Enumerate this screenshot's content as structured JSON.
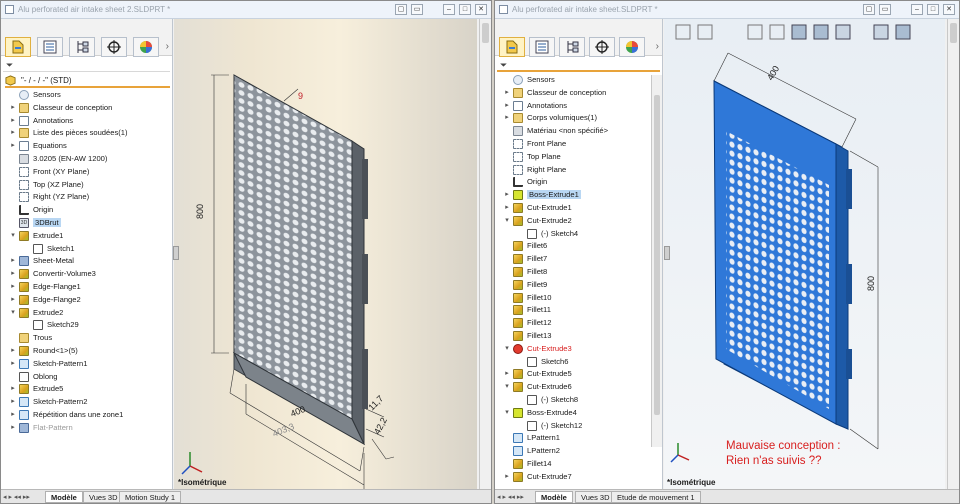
{
  "left": {
    "title": "Alu perforated air intake sheet 2.SLDPRT *",
    "root_label": "\"- / - / -\" (STD)",
    "tree": [
      {
        "label": "Sensors",
        "icon": "sensor-icon",
        "indent": 0,
        "exp": ""
      },
      {
        "label": "Classeur de conception",
        "icon": "folder-icon",
        "indent": 0,
        "exp": "▸"
      },
      {
        "label": "Annotations",
        "icon": "annotations-icon",
        "indent": 0,
        "exp": "▸"
      },
      {
        "label": "Liste des pièces soudées(1)",
        "icon": "folder-icon",
        "indent": 0,
        "exp": "▸"
      },
      {
        "label": "Equations",
        "icon": "equations-icon",
        "indent": 0,
        "exp": "▸"
      },
      {
        "label": "3.0205 (EN-AW 1200)",
        "icon": "material-icon",
        "indent": 0,
        "exp": ""
      },
      {
        "label": "Front (XY Plane)",
        "icon": "plane-icon",
        "indent": 0,
        "exp": ""
      },
      {
        "label": "Top (XZ Plane)",
        "icon": "plane-icon",
        "indent": 0,
        "exp": ""
      },
      {
        "label": "Right (YZ Plane)",
        "icon": "plane-icon",
        "indent": 0,
        "exp": ""
      },
      {
        "label": "Origin",
        "icon": "origin-icon",
        "indent": 0,
        "exp": ""
      },
      {
        "label": "3DBrut",
        "icon": "sketch3d-icon",
        "indent": 0,
        "exp": "",
        "selected": true
      },
      {
        "label": "Extrude1",
        "icon": "extrude-icon",
        "indent": 0,
        "exp": "▾"
      },
      {
        "label": "Sketch1",
        "icon": "sketch-icon",
        "indent": 1,
        "exp": ""
      },
      {
        "label": "Sheet-Metal",
        "icon": "sheet-metal-icon",
        "indent": 0,
        "exp": "▸"
      },
      {
        "label": "Convertir-Volume3",
        "icon": "convert-icon",
        "indent": 0,
        "exp": "▸"
      },
      {
        "label": "Edge-Flange1",
        "icon": "flange-icon",
        "indent": 0,
        "exp": "▸"
      },
      {
        "label": "Edge-Flange2",
        "icon": "flange-icon",
        "indent": 0,
        "exp": "▸"
      },
      {
        "label": "Extrude2",
        "icon": "extrude-icon",
        "indent": 0,
        "exp": "▾"
      },
      {
        "label": "Sketch29",
        "icon": "sketch-icon",
        "indent": 1,
        "exp": ""
      },
      {
        "label": "Trous",
        "icon": "folder-icon",
        "indent": 0,
        "exp": ""
      },
      {
        "label": "Round<1>(5)",
        "icon": "feature-icon",
        "indent": 0,
        "exp": "▸"
      },
      {
        "label": "Sketch-Pattern1",
        "icon": "pattern-icon",
        "indent": 0,
        "exp": "▸"
      },
      {
        "label": "Oblong",
        "icon": "sketch-icon",
        "indent": 0,
        "exp": ""
      },
      {
        "label": "Extrude5",
        "icon": "extrude-icon",
        "indent": 0,
        "exp": "▸"
      },
      {
        "label": "Sketch-Pattern2",
        "icon": "pattern-icon",
        "indent": 0,
        "exp": "▸"
      },
      {
        "label": "Répétition dans une zone1",
        "icon": "pattern-icon",
        "indent": 0,
        "exp": "▸"
      },
      {
        "label": "Flat-Pattern",
        "icon": "flat-pattern-icon",
        "indent": 0,
        "exp": "▸",
        "grey": true
      }
    ],
    "tabs": [
      "Modèle",
      "Vues 3D",
      "Motion Study 1"
    ],
    "view_label": "*Isométrique",
    "dims": {
      "height": "800",
      "width": "400",
      "diag": "403,3",
      "depth": "42,2",
      "flange": "11,7",
      "hole": "9"
    }
  },
  "right": {
    "title": "Alu perforated air intake sheet.SLDPRT *",
    "tree": [
      {
        "label": "Sensors",
        "icon": "sensor-icon",
        "indent": 0,
        "exp": ""
      },
      {
        "label": "Classeur de conception",
        "icon": "folder-icon",
        "indent": 0,
        "exp": "▸"
      },
      {
        "label": "Annotations",
        "icon": "annotations-icon",
        "indent": 0,
        "exp": "▸"
      },
      {
        "label": "Corps volumiques(1)",
        "icon": "folder-icon",
        "indent": 0,
        "exp": "▸"
      },
      {
        "label": "Matériau <non spécifié>",
        "icon": "material-icon",
        "indent": 0,
        "exp": ""
      },
      {
        "label": "Front Plane",
        "icon": "plane-icon",
        "indent": 0,
        "exp": ""
      },
      {
        "label": "Top Plane",
        "icon": "plane-icon",
        "indent": 0,
        "exp": ""
      },
      {
        "label": "Right Plane",
        "icon": "plane-icon",
        "indent": 0,
        "exp": ""
      },
      {
        "label": "Origin",
        "icon": "origin-icon",
        "indent": 0,
        "exp": ""
      },
      {
        "label": "Boss-Extrude1",
        "icon": "boss-icon",
        "indent": 0,
        "exp": "▸",
        "selected": true
      },
      {
        "label": "Cut-Extrude1",
        "icon": "cut-icon",
        "indent": 0,
        "exp": "▸"
      },
      {
        "label": "Cut-Extrude2",
        "icon": "cut-icon",
        "indent": 0,
        "exp": "▾"
      },
      {
        "label": "(-) Sketch4",
        "icon": "sketch-icon",
        "indent": 1,
        "exp": ""
      },
      {
        "label": "Fillet6",
        "icon": "fillet-icon",
        "indent": 0,
        "exp": ""
      },
      {
        "label": "Fillet7",
        "icon": "fillet-icon",
        "indent": 0,
        "exp": ""
      },
      {
        "label": "Fillet8",
        "icon": "fillet-icon",
        "indent": 0,
        "exp": ""
      },
      {
        "label": "Fillet9",
        "icon": "fillet-icon",
        "indent": 0,
        "exp": ""
      },
      {
        "label": "Fillet10",
        "icon": "fillet-icon",
        "indent": 0,
        "exp": ""
      },
      {
        "label": "Fillet11",
        "icon": "fillet-icon",
        "indent": 0,
        "exp": ""
      },
      {
        "label": "Fillet12",
        "icon": "fillet-icon",
        "indent": 0,
        "exp": ""
      },
      {
        "label": "Fillet13",
        "icon": "fillet-icon",
        "indent": 0,
        "exp": ""
      },
      {
        "label": "Cut-Extrude3",
        "icon": "error-icon",
        "indent": 0,
        "exp": "▾",
        "error": true
      },
      {
        "label": "Sketch6",
        "icon": "sketch-icon",
        "indent": 1,
        "exp": ""
      },
      {
        "label": "Cut-Extrude5",
        "icon": "cut-icon",
        "indent": 0,
        "exp": "▸"
      },
      {
        "label": "Cut-Extrude6",
        "icon": "cut-icon",
        "indent": 0,
        "exp": "▾"
      },
      {
        "label": "(-) Sketch8",
        "icon": "sketch-icon",
        "indent": 1,
        "exp": ""
      },
      {
        "label": "Boss-Extrude4",
        "icon": "boss-icon",
        "indent": 0,
        "exp": "▾"
      },
      {
        "label": "(-) Sketch12",
        "icon": "sketch-icon",
        "indent": 1,
        "exp": ""
      },
      {
        "label": "LPattern1",
        "icon": "pattern-icon",
        "indent": 0,
        "exp": ""
      },
      {
        "label": "LPattern2",
        "icon": "pattern-icon",
        "indent": 0,
        "exp": ""
      },
      {
        "label": "Fillet14",
        "icon": "fillet-icon",
        "indent": 0,
        "exp": ""
      },
      {
        "label": "Cut-Extrude7",
        "icon": "cut-icon",
        "indent": 0,
        "exp": "▸"
      }
    ],
    "tabs": [
      "Modèle",
      "Vues 3D",
      "Etude de mouvement 1"
    ],
    "view_label": "*Isométrique",
    "dims": {
      "width": "400",
      "height": "800"
    },
    "note_line1": "Mauvaise conception :",
    "note_line2": "Rien n'as suivis ??"
  },
  "colors": {
    "error_red": "#d82020",
    "selection_blue": "#b9d7f3",
    "part_blue": "#2f78d8",
    "accent_orange": "#e8a33a"
  }
}
